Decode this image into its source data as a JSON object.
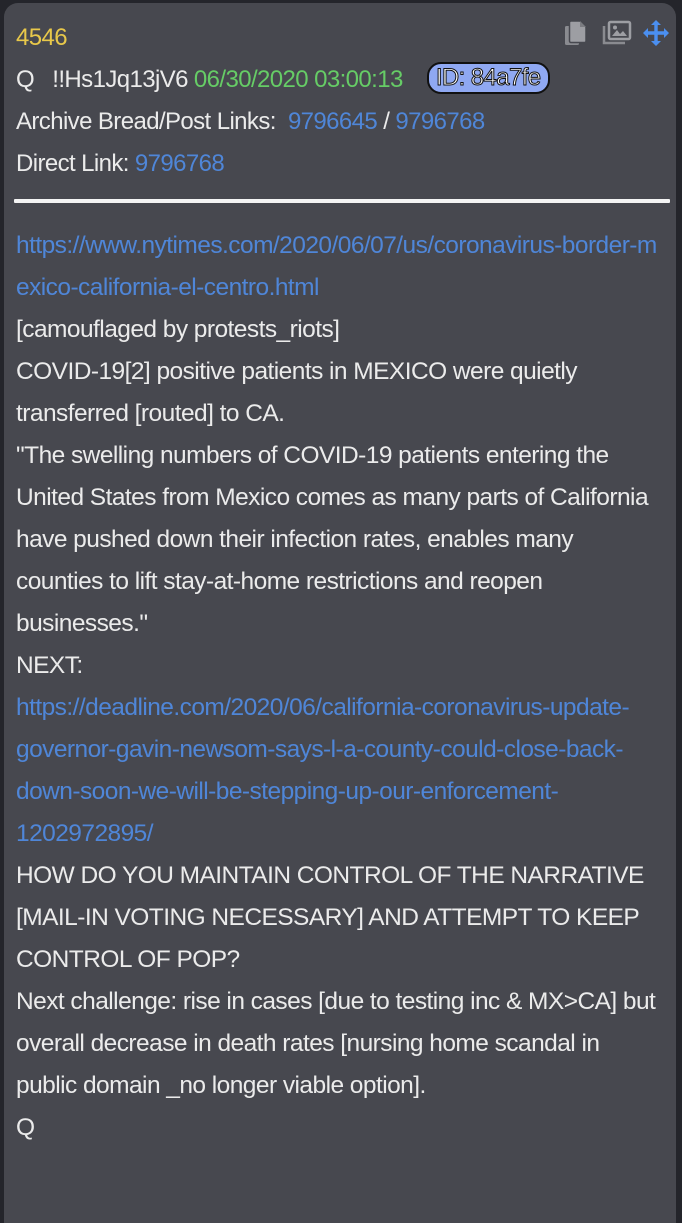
{
  "post": {
    "number": "4546",
    "author": "Q",
    "tripcode": "!!Hs1Jq13jV6",
    "datetime": "06/30/2020 03:00:13",
    "id_badge": "ID: 84a7fe",
    "archive_label": "Archive Bread/Post Links:",
    "archive_link_1": "9796645",
    "archive_separator": "/",
    "archive_link_2": "9796768",
    "direct_label": "Direct Link:",
    "direct_link": "9796768"
  },
  "icons": {
    "copy": "copy-icon",
    "images": "images-icon",
    "move": "move-icon"
  },
  "colors": {
    "post_number": "#e8c84a",
    "datetime": "#66cc66",
    "link": "#4f86d8",
    "id_badge_bg": "#8fa8f2",
    "panel_bg": "#47484f",
    "page_bg": "#24252b",
    "text": "#ebebeb"
  },
  "content": {
    "link_nytimes": "https://www.nytimes.com/2020/06/07/us/coronavirus-border-mexico-california-el-centro.html",
    "line_camouflaged": "[camouflaged by protests_riots]",
    "line_covid_transfer": "COVID-19[2] positive patients in MEXICO were quietly transferred [routed] to CA.",
    "line_quote": "\"The swelling numbers of COVID-19 patients entering the United States from Mexico comes as many parts of California have pushed down their infection rates, enables many counties to lift stay-at-home restrictions and reopen businesses.\"",
    "line_next": "NEXT:",
    "link_deadline": "https://deadline.com/2020/06/california-coronavirus-update-governor-gavin-newsom-says-l-a-county-could-close-back-down-soon-we-will-be-stepping-up-our-enforcement-1202972895/",
    "line_how": "HOW DO YOU MAINTAIN CONTROL OF THE NARRATIVE [MAIL-IN VOTING NECESSARY] AND ATTEMPT TO KEEP CONTROL OF POP?",
    "line_challenge": "Next challenge: rise in cases [due to testing inc & MX>CA] but overall decrease in death rates [nursing home scandal in public domain _no longer viable option].",
    "signature": "Q"
  }
}
